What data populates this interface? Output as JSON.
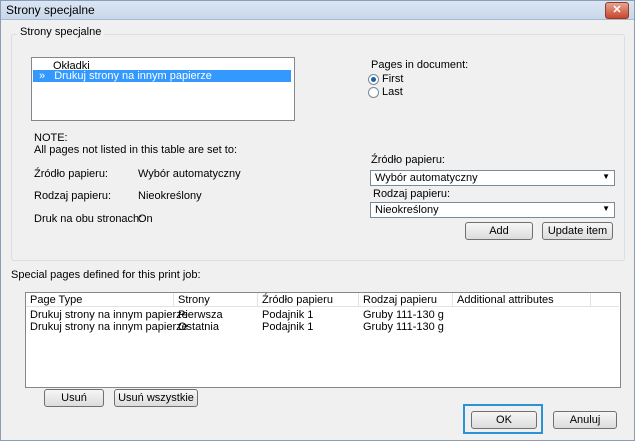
{
  "window": {
    "title": "Strony specjalne",
    "close_symbol": "✕"
  },
  "group": {
    "label": "Strony specjalne"
  },
  "page_list": {
    "items": [
      {
        "marker": "",
        "label": "Okładki",
        "selected": false
      },
      {
        "marker": "»",
        "label": "Drukuj strony na innym papierze",
        "selected": true
      }
    ]
  },
  "pages_in_document": {
    "label": "Pages in document:",
    "options": [
      {
        "label": "First",
        "checked": true
      },
      {
        "label": "Last",
        "checked": false
      }
    ]
  },
  "note": {
    "title": "NOTE:",
    "text": "All pages not listed in this table are set to:",
    "rows": [
      {
        "label": "Źródło papieru:",
        "value": "Wybór automatyczny"
      },
      {
        "label": "Rodzaj papieru:",
        "value": "Nieokreślony"
      },
      {
        "label": "Druk na obu stronach:",
        "value": "On"
      }
    ]
  },
  "paper_source": {
    "label": "Źródło papieru:",
    "value": "Wybór automatyczny"
  },
  "paper_type": {
    "label": "Rodzaj papieru:",
    "value": "Nieokreślony"
  },
  "buttons": {
    "add": "Add",
    "update": "Update item",
    "remove": "Usuń",
    "remove_all": "Usuń wszystkie",
    "ok": "OK",
    "cancel": "Anuluj"
  },
  "special_pages_label": "Special pages defined for this print job:",
  "table": {
    "columns": [
      "Page Type",
      "Strony",
      "Źródło papieru",
      "Rodzaj papieru",
      "Additional attributes"
    ],
    "rows": [
      [
        "Drukuj strony na innym papierze",
        "Pierwsza",
        "Podajnik 1",
        "Gruby 111-130 g",
        ""
      ],
      [
        "Drukuj strony na innym papierze",
        "Ostatnia",
        "Podajnik 1",
        "Gruby 111-130 g",
        ""
      ]
    ]
  }
}
